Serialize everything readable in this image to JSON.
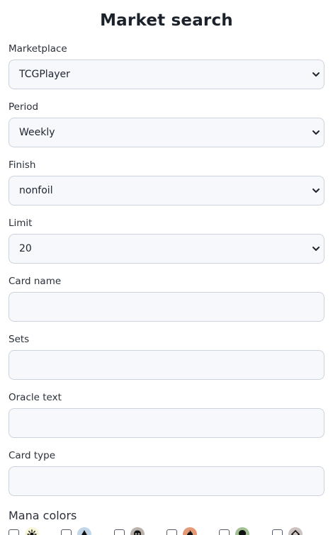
{
  "page": {
    "title": "Market search"
  },
  "fields": {
    "marketplace": {
      "label": "Marketplace",
      "value": "TCGPlayer"
    },
    "period": {
      "label": "Period",
      "value": "Weekly"
    },
    "finish": {
      "label": "Finish",
      "value": "nonfoil"
    },
    "limit": {
      "label": "Limit",
      "value": "20"
    },
    "card_name": {
      "label": "Card name",
      "value": ""
    },
    "sets": {
      "label": "Sets",
      "value": ""
    },
    "oracle_text": {
      "label": "Oracle text",
      "value": ""
    },
    "card_type": {
      "label": "Card type",
      "value": ""
    }
  },
  "mana": {
    "label": "Mana colors",
    "colors": [
      {
        "icon": "white-mana-icon",
        "color": "#f8f6d8"
      },
      {
        "icon": "blue-mana-icon",
        "color": "#c1d7e9"
      },
      {
        "icon": "black-mana-icon",
        "color": "#bab1ab"
      },
      {
        "icon": "red-mana-icon",
        "color": "#e49977"
      },
      {
        "icon": "green-mana-icon",
        "color": "#a3c095"
      },
      {
        "icon": "colorless-mana-icon",
        "color": "#ccc2c0"
      }
    ]
  }
}
